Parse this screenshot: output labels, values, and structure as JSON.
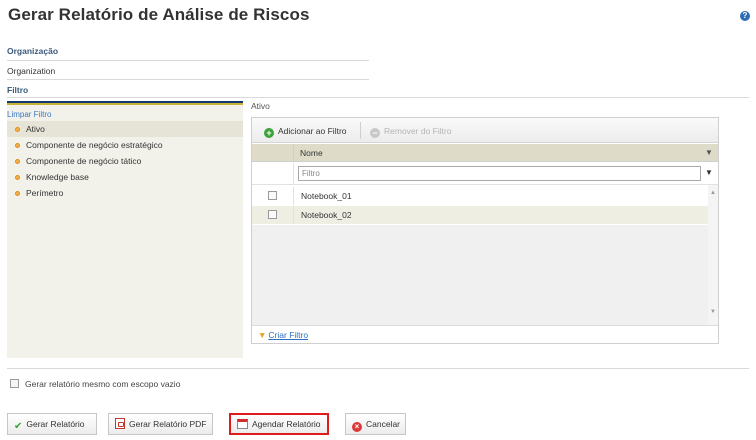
{
  "page": {
    "title": "Gerar Relatório de Análise de Riscos",
    "help_icon": "?"
  },
  "organization": {
    "label": "Organização",
    "value": "Organization"
  },
  "filter": {
    "label": "Filtro",
    "clear_link": "Limpar Filtro",
    "tree": [
      {
        "label": "Ativo",
        "selected": true
      },
      {
        "label": "Componente de negócio estratégico",
        "selected": false
      },
      {
        "label": "Componente de negócio tático",
        "selected": false
      },
      {
        "label": "Knowledge base",
        "selected": false
      },
      {
        "label": "Perímetro",
        "selected": false
      }
    ]
  },
  "asset_panel": {
    "title": "Ativo",
    "toolbar": {
      "add_label": "Adicionar ao Filtro",
      "remove_label": "Remover do Filtro"
    },
    "column_header": "Nome",
    "filter_placeholder": "Filtro",
    "rows": [
      {
        "name": "Notebook_01",
        "checked": false
      },
      {
        "name": "Notebook_02",
        "checked": false
      }
    ],
    "footer_link": "Criar Filtro"
  },
  "options": {
    "empty_scope_label": "Gerar relatório mesmo com escopo vazio",
    "empty_scope_checked": false
  },
  "buttons": {
    "generate": "Gerar Relatório",
    "generate_pdf": "Gerar Relatório PDF",
    "schedule": "Agendar Relatório",
    "cancel": "Cancelar"
  },
  "colors": {
    "highlight_border": "#e01b1b",
    "accent_navy": "#14396b",
    "accent_gold": "#c9b237",
    "link": "#2a6fc1"
  }
}
